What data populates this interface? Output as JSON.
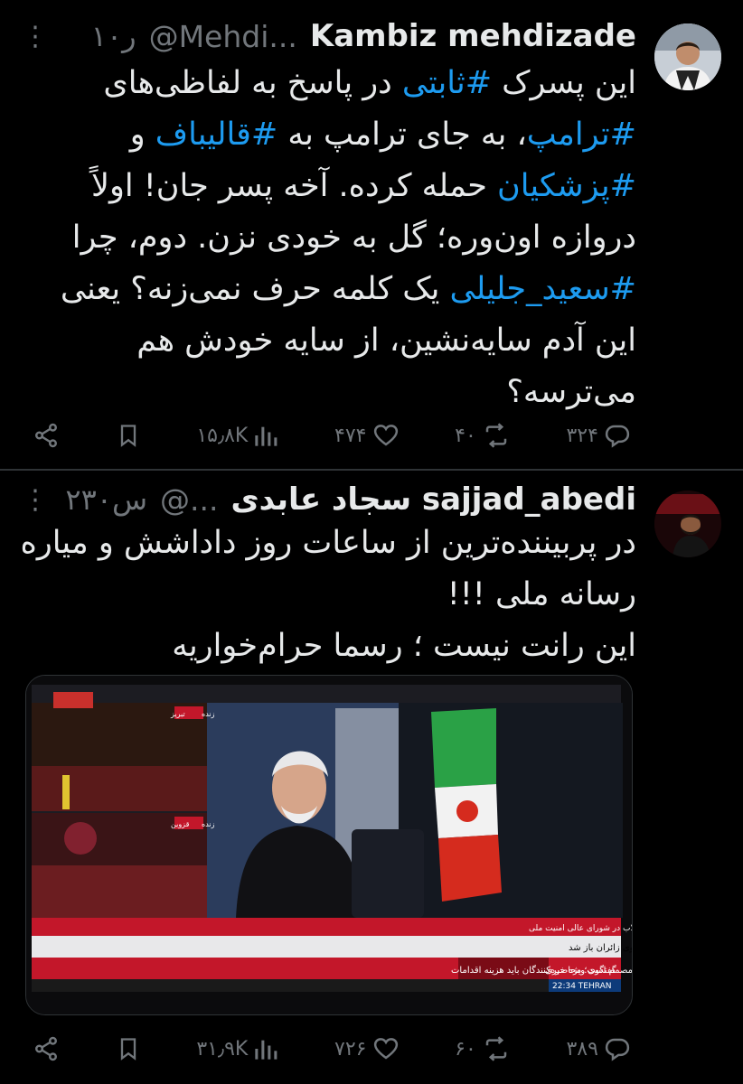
{
  "tweet1": {
    "author_name": "Kambiz mehdizade",
    "handle": "@Mehdi...",
    "time": "۱۰ر",
    "more": "⋮",
    "lines": [
      [
        {
          "t": "این پسرک "
        },
        {
          "t": "#ثابتی",
          "h": true
        },
        {
          "t": " در پاسخ به لفاظی‌های"
        }
      ],
      [
        {
          "t": "#ترامپ",
          "h": true
        },
        {
          "t": "، به جای ترامپ به "
        },
        {
          "t": "#قالیباف",
          "h": true
        },
        {
          "t": " و"
        }
      ],
      [
        {
          "t": "#پزشکیان",
          "h": true
        },
        {
          "t": " حمله کرده. آخه پسر جان! اولاً"
        }
      ],
      [
        {
          "t": "دروازه اون‌وره؛ گل به خودی نزن. دوم، چرا"
        }
      ],
      [
        {
          "t": "#سعید_جلیلی",
          "h": true
        },
        {
          "t": " یک کلمه حرف نمی‌زنه؟ یعنی"
        }
      ],
      [
        {
          "t": "این آدم سایه‌نشین، از سایه خودش هم"
        }
      ],
      [
        {
          "t": "می‌ترسه؟"
        }
      ]
    ],
    "actions": {
      "reply": "۳۲۴",
      "retweet": "۴۰",
      "like": "۴۷۴",
      "views": "۱۵٫۸K"
    }
  },
  "tweet2": {
    "author_name": "سجاد عابدی sajjad_abedi",
    "handle": "@...",
    "time": "۲۳۰س",
    "more": "⋮",
    "lines": [
      [
        {
          "t": "در پربیننده‌ترین از ساعات روز داداشش و میاره"
        }
      ],
      [
        {
          "t": "رسانه ملی !!!"
        }
      ],
      [
        {
          "t": "این رانت نیست ؛ رسما حرام‌خواریه"
        }
      ]
    ],
    "actions": {
      "reply": "۳۸۹",
      "retweet": "۶۰",
      "like": "۷۲۶",
      "views": "۳۱٫۹K"
    },
    "media": {
      "caption_name": "سعید جلیلی . نماینده رهبر معظم انقلاب در شورای عالی امنیت ملی",
      "ticker_top": "رواق دارالذکر حرم مطهر امام رضا (ع) برای زیارت مزار امام مجاهد شهید به روی زائران باز شد",
      "ticker_bottom": "محمد مفتاح: دولت یمن برای شکستن محاصره مصمم است؛ محاصره‌کنندگان باید هزینه اقدامات",
      "program_label": "گفتگوی ویژه خبری",
      "clock": "22:34 TEHRAN",
      "live_label_1": "زنده",
      "city_1": "تبریز",
      "live_label_2": "زنده",
      "city_2": "قزوین"
    }
  }
}
